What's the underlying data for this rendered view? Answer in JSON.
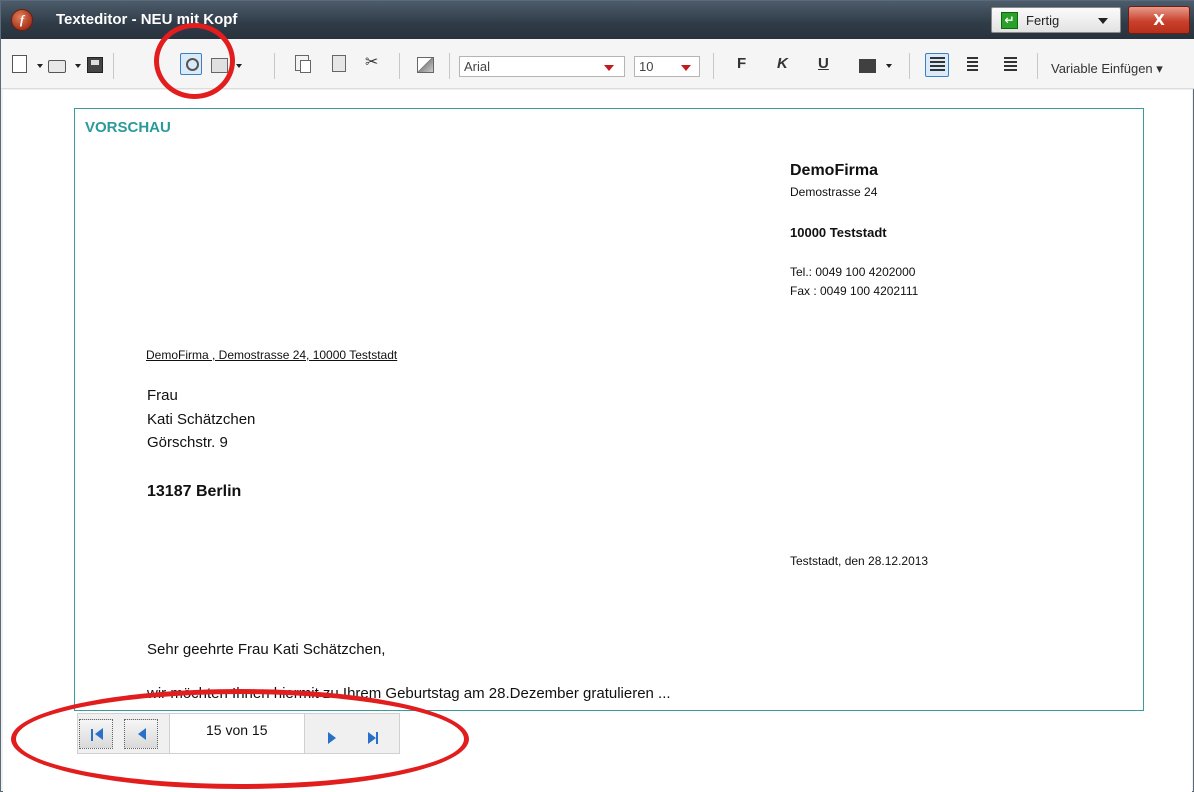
{
  "window": {
    "title": "Texteditor - NEU mit Kopf",
    "app_icon_letter": "f",
    "done_label": "Fertig",
    "close_glyph": "X"
  },
  "toolbar": {
    "font_name": "Arial",
    "font_size": "10",
    "bold_label": "F",
    "italic_label": "K",
    "underline_label": "U",
    "insert_variable_label": "Variable Einfügen",
    "icons": [
      "new-document-icon",
      "open-folder-icon",
      "save-icon",
      "preview-icon",
      "print-icon",
      "copy-icon",
      "paste-icon",
      "cut-icon",
      "insert-image-icon",
      "font-color-icon",
      "align-left-icon",
      "align-center-icon",
      "align-right-icon"
    ]
  },
  "preview": {
    "heading": "VORSCHAU",
    "sender": {
      "company": "DemoFirma",
      "street": "Demostrasse 24",
      "city": "10000  Teststadt",
      "tel": "Tel.: 0049 100 4202000",
      "fax": "Fax : 0049 100 4202111"
    },
    "return_address": "DemoFirma , Demostrasse  24, 10000 Teststadt",
    "recipient": {
      "salutation": "Frau",
      "name": "Kati  Schätzchen",
      "street": "Görschstr. 9",
      "city": "13187  Berlin"
    },
    "date_line": "Teststadt, den 28.12.2013",
    "greeting": "Sehr geehrte Frau Kati Schätzchen,",
    "body_line": "wir möchten Ihnen hiermit zu Ihrem Geburtstag am 28.Dezember gratulieren ..."
  },
  "pager": {
    "display": "15 von 15"
  },
  "colors": {
    "accent_teal": "#2a9a9a",
    "highlight_red": "#e21d1d",
    "nav_blue": "#2970c8"
  }
}
